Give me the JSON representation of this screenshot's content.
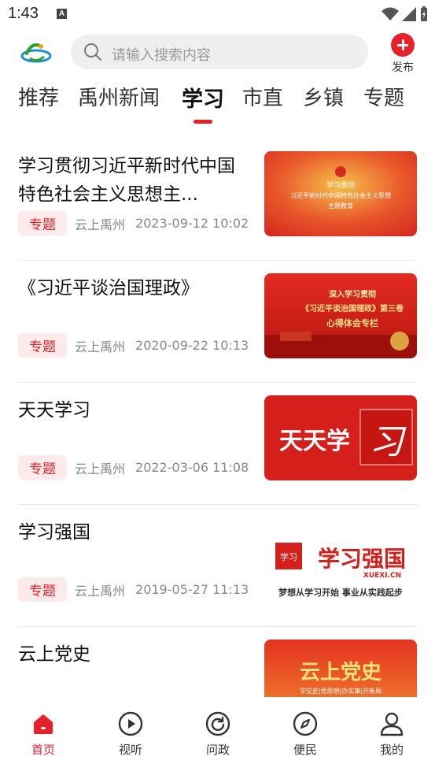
{
  "status_bar": {
    "time": "1:43",
    "notif_glyph": "A"
  },
  "header": {
    "search_placeholder": "请输入搜索内容",
    "publish_label": "发布"
  },
  "tabs": [
    {
      "label": "推荐"
    },
    {
      "label": "禹州新闻"
    },
    {
      "label": "学习",
      "active": true
    },
    {
      "label": "市直"
    },
    {
      "label": "乡镇"
    },
    {
      "label": "专题"
    }
  ],
  "articles": [
    {
      "title": "学习贯彻习近平新时代中国特色社会主义思想主...",
      "tag": "专题",
      "source": "云上禹州",
      "time": "2023-09-12 10:02",
      "thumb": {
        "line1": "学习贯彻",
        "line2": "习近平新时代中国特色社会主义思想",
        "line3": "主题教育"
      }
    },
    {
      "title": "《习近平谈治国理政》",
      "tag": "专题",
      "source": "云上禹州",
      "time": "2020-09-22 10:13",
      "thumb": {
        "line1": "深入学习贯彻",
        "line2": "《习近平谈治国理政》第三卷",
        "line3": "心得体会专栏"
      }
    },
    {
      "title": "天天学习",
      "tag": "专题",
      "source": "云上禹州",
      "time": "2022-03-06 11:08",
      "thumb": {
        "line1": "天天学",
        "line2": "习"
      }
    },
    {
      "title": "学习强国",
      "tag": "专题",
      "source": "云上禹州",
      "time": "2019-05-27 11:13",
      "thumb": {
        "line1": "学习强国",
        "line2": "XUEXI.CN",
        "line3": "梦想从学习开始  事业从实践起步"
      }
    },
    {
      "title": "云上党史",
      "thumb": {
        "line1": "云上党史",
        "line2": "学党史|悟思想|办实事|开新局"
      }
    }
  ],
  "bottom_nav": [
    {
      "label": "首页",
      "icon": "home-icon",
      "active": true
    },
    {
      "label": "视听",
      "icon": "play-icon"
    },
    {
      "label": "问政",
      "icon": "refresh-circle-icon"
    },
    {
      "label": "便民",
      "icon": "compass-icon"
    },
    {
      "label": "我的",
      "icon": "user-icon"
    }
  ],
  "colors": {
    "accent": "#e8202a",
    "tag_bg": "#fdeaea"
  }
}
